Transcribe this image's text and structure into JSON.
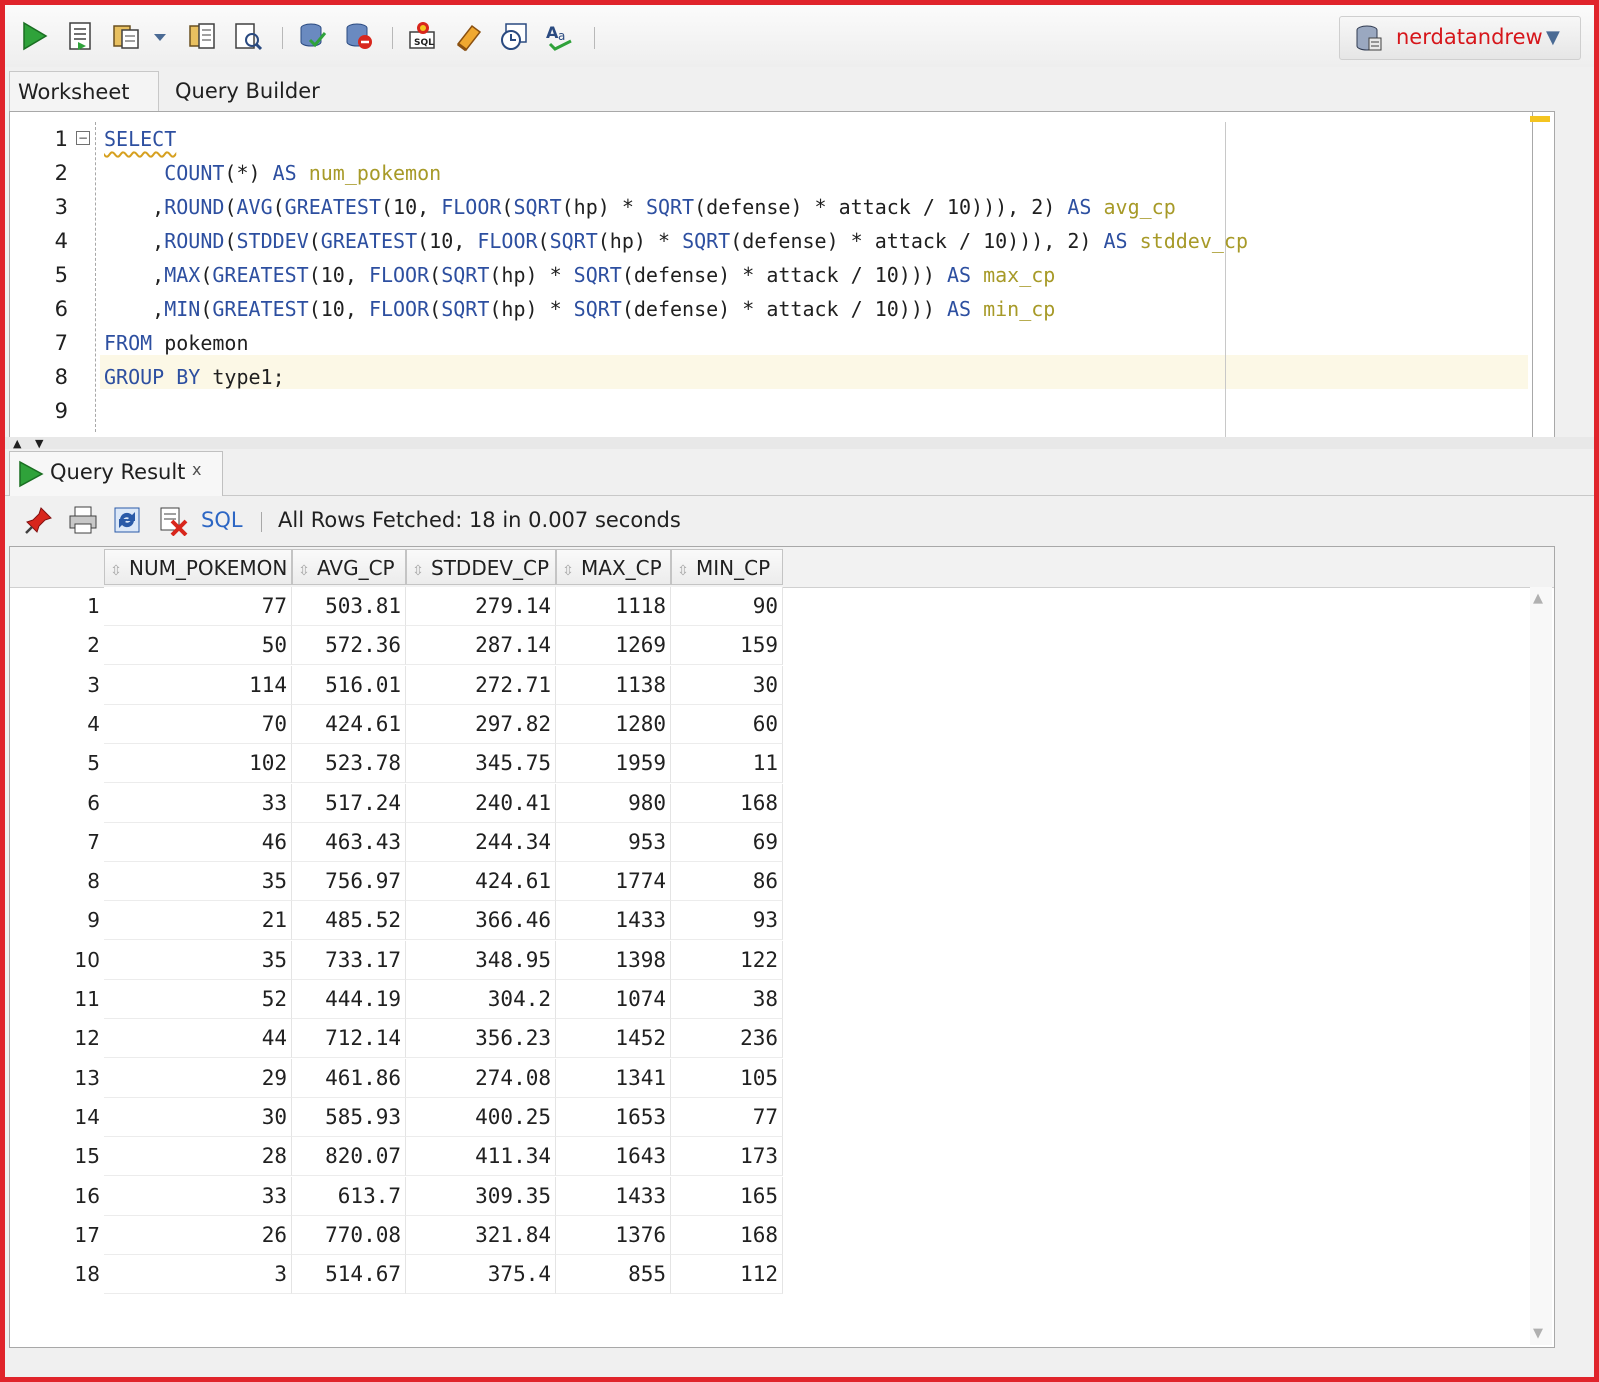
{
  "toolbar": {
    "icons": [
      "run-statement-icon",
      "run-script-icon",
      "autotrace-icon",
      "dropdown-icon",
      "explain-plan-icon",
      "sql-tuning-icon",
      "commit-icon",
      "rollback-icon",
      "sql-worksheet-icon",
      "clear-icon",
      "history-icon",
      "format-icon"
    ],
    "connection": "nerdatandrew"
  },
  "editor_tabs": {
    "worksheet": "Worksheet",
    "query_builder": "Query Builder"
  },
  "editor": {
    "line_numbers": [
      "1",
      "2",
      "3",
      "4",
      "5",
      "6",
      "7",
      "8",
      "9"
    ],
    "lines": [
      [
        {
          "t": "SELECT",
          "c": "kw sq"
        }
      ],
      [
        {
          "t": "     COUNT",
          "c": "kw"
        },
        {
          "t": "(*) ",
          "c": "tx"
        },
        {
          "t": "AS ",
          "c": "kw"
        },
        {
          "t": "num_pokemon",
          "c": "al"
        }
      ],
      [
        {
          "t": "    ,",
          "c": "tx"
        },
        {
          "t": "ROUND",
          "c": "kw"
        },
        {
          "t": "(",
          "c": "tx"
        },
        {
          "t": "AVG",
          "c": "kw"
        },
        {
          "t": "(",
          "c": "tx"
        },
        {
          "t": "GREATEST",
          "c": "kw"
        },
        {
          "t": "(10, ",
          "c": "tx"
        },
        {
          "t": "FLOOR",
          "c": "kw"
        },
        {
          "t": "(",
          "c": "tx"
        },
        {
          "t": "SQRT",
          "c": "kw"
        },
        {
          "t": "(hp) * ",
          "c": "tx"
        },
        {
          "t": "SQRT",
          "c": "kw"
        },
        {
          "t": "(defense) * attack / 10))), 2) ",
          "c": "tx"
        },
        {
          "t": "AS ",
          "c": "kw"
        },
        {
          "t": "avg_cp",
          "c": "al"
        }
      ],
      [
        {
          "t": "    ,",
          "c": "tx"
        },
        {
          "t": "ROUND",
          "c": "kw"
        },
        {
          "t": "(",
          "c": "tx"
        },
        {
          "t": "STDDEV",
          "c": "kw"
        },
        {
          "t": "(",
          "c": "tx"
        },
        {
          "t": "GREATEST",
          "c": "kw"
        },
        {
          "t": "(10, ",
          "c": "tx"
        },
        {
          "t": "FLOOR",
          "c": "kw"
        },
        {
          "t": "(",
          "c": "tx"
        },
        {
          "t": "SQRT",
          "c": "kw"
        },
        {
          "t": "(hp) * ",
          "c": "tx"
        },
        {
          "t": "SQRT",
          "c": "kw"
        },
        {
          "t": "(defense) * attack / 10))), 2) ",
          "c": "tx"
        },
        {
          "t": "AS ",
          "c": "kw"
        },
        {
          "t": "stddev_cp",
          "c": "al"
        }
      ],
      [
        {
          "t": "    ,",
          "c": "tx"
        },
        {
          "t": "MAX",
          "c": "kw"
        },
        {
          "t": "(",
          "c": "tx"
        },
        {
          "t": "GREATEST",
          "c": "kw"
        },
        {
          "t": "(10, ",
          "c": "tx"
        },
        {
          "t": "FLOOR",
          "c": "kw"
        },
        {
          "t": "(",
          "c": "tx"
        },
        {
          "t": "SQRT",
          "c": "kw"
        },
        {
          "t": "(hp) * ",
          "c": "tx"
        },
        {
          "t": "SQRT",
          "c": "kw"
        },
        {
          "t": "(defense) * attack / 10))) ",
          "c": "tx"
        },
        {
          "t": "AS ",
          "c": "kw"
        },
        {
          "t": "max_cp",
          "c": "al"
        }
      ],
      [
        {
          "t": "    ,",
          "c": "tx"
        },
        {
          "t": "MIN",
          "c": "kw"
        },
        {
          "t": "(",
          "c": "tx"
        },
        {
          "t": "GREATEST",
          "c": "kw"
        },
        {
          "t": "(10, ",
          "c": "tx"
        },
        {
          "t": "FLOOR",
          "c": "kw"
        },
        {
          "t": "(",
          "c": "tx"
        },
        {
          "t": "SQRT",
          "c": "kw"
        },
        {
          "t": "(hp) * ",
          "c": "tx"
        },
        {
          "t": "SQRT",
          "c": "kw"
        },
        {
          "t": "(defense) * attack / 10))) ",
          "c": "tx"
        },
        {
          "t": "AS ",
          "c": "kw"
        },
        {
          "t": "min_cp",
          "c": "al"
        }
      ],
      [
        {
          "t": "FROM ",
          "c": "kw"
        },
        {
          "t": "pokemon",
          "c": "tx"
        }
      ],
      [
        {
          "t": "GROUP BY ",
          "c": "kw"
        },
        {
          "t": "type1;",
          "c": "tx"
        }
      ],
      []
    ]
  },
  "result": {
    "tab_label": "Query Result",
    "tab_close": "x",
    "sql_link": "SQL",
    "status": "All Rows Fetched: 18 in 0.007 seconds",
    "columns": [
      "NUM_POKEMON",
      "AVG_CP",
      "STDDEV_CP",
      "MAX_CP",
      "MIN_CP"
    ],
    "rows": [
      [
        "1",
        "77",
        "503.81",
        "279.14",
        "1118",
        "90"
      ],
      [
        "2",
        "50",
        "572.36",
        "287.14",
        "1269",
        "159"
      ],
      [
        "3",
        "114",
        "516.01",
        "272.71",
        "1138",
        "30"
      ],
      [
        "4",
        "70",
        "424.61",
        "297.82",
        "1280",
        "60"
      ],
      [
        "5",
        "102",
        "523.78",
        "345.75",
        "1959",
        "11"
      ],
      [
        "6",
        "33",
        "517.24",
        "240.41",
        "980",
        "168"
      ],
      [
        "7",
        "46",
        "463.43",
        "244.34",
        "953",
        "69"
      ],
      [
        "8",
        "35",
        "756.97",
        "424.61",
        "1774",
        "86"
      ],
      [
        "9",
        "21",
        "485.52",
        "366.46",
        "1433",
        "93"
      ],
      [
        "10",
        "35",
        "733.17",
        "348.95",
        "1398",
        "122"
      ],
      [
        "11",
        "52",
        "444.19",
        "304.2",
        "1074",
        "38"
      ],
      [
        "12",
        "44",
        "712.14",
        "356.23",
        "1452",
        "236"
      ],
      [
        "13",
        "29",
        "461.86",
        "274.08",
        "1341",
        "105"
      ],
      [
        "14",
        "30",
        "585.93",
        "400.25",
        "1653",
        "77"
      ],
      [
        "15",
        "28",
        "820.07",
        "411.34",
        "1643",
        "173"
      ],
      [
        "16",
        "33",
        "613.7",
        "309.35",
        "1433",
        "165"
      ],
      [
        "17",
        "26",
        "770.08",
        "321.84",
        "1376",
        "168"
      ],
      [
        "18",
        "3",
        "514.67",
        "375.4",
        "855",
        "112"
      ]
    ]
  },
  "colors": {
    "frame": "#e0242b",
    "keyword": "#2d4fa0",
    "alias": "#a79a28",
    "connection_text": "#d6161b",
    "link": "#2c66c4"
  }
}
